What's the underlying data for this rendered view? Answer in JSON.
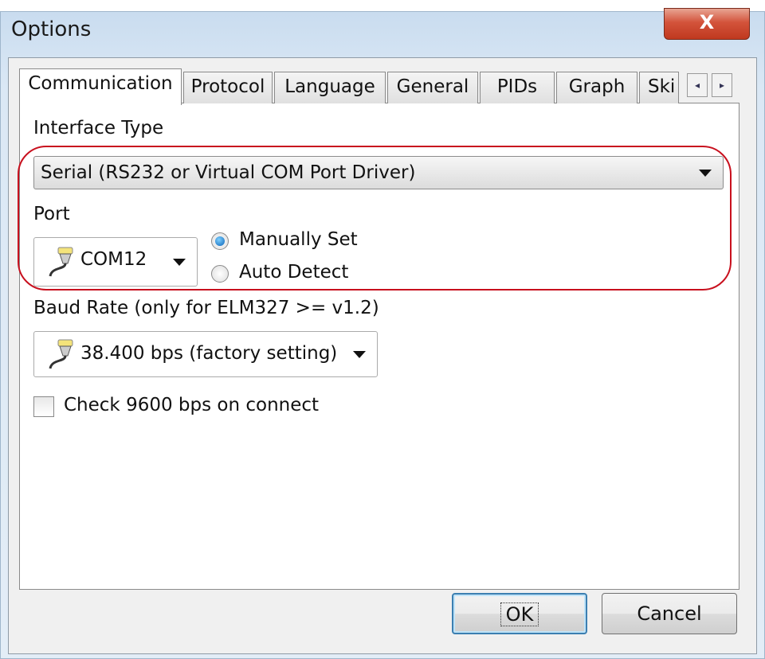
{
  "window": {
    "title": "Options",
    "close_label": "X"
  },
  "tabs": [
    {
      "label": "Communication",
      "active": true
    },
    {
      "label": "Protocol"
    },
    {
      "label": "Language"
    },
    {
      "label": "General"
    },
    {
      "label": "PIDs"
    },
    {
      "label": "Graph"
    },
    {
      "label": "Ski"
    }
  ],
  "tab_scroll": {
    "left": "◂",
    "right": "▸"
  },
  "communication": {
    "interface_type_label": "Interface Type",
    "interface_type_value": "Serial (RS232 or Virtual COM Port Driver)",
    "port_label": "Port",
    "port_value": "COM12",
    "port_mode": {
      "options": [
        "Manually Set",
        "Auto Detect"
      ],
      "selected": "Manually Set"
    },
    "baud_label": "Baud Rate (only for ELM327 >= v1.2)",
    "baud_value": "38.400 bps (factory setting)",
    "check_9600_label": "Check 9600 bps on connect",
    "check_9600_checked": false
  },
  "buttons": {
    "ok": "OK",
    "cancel": "Cancel"
  },
  "colors": {
    "highlight": "#c8101e",
    "radio_selected": "#0a63b8"
  }
}
